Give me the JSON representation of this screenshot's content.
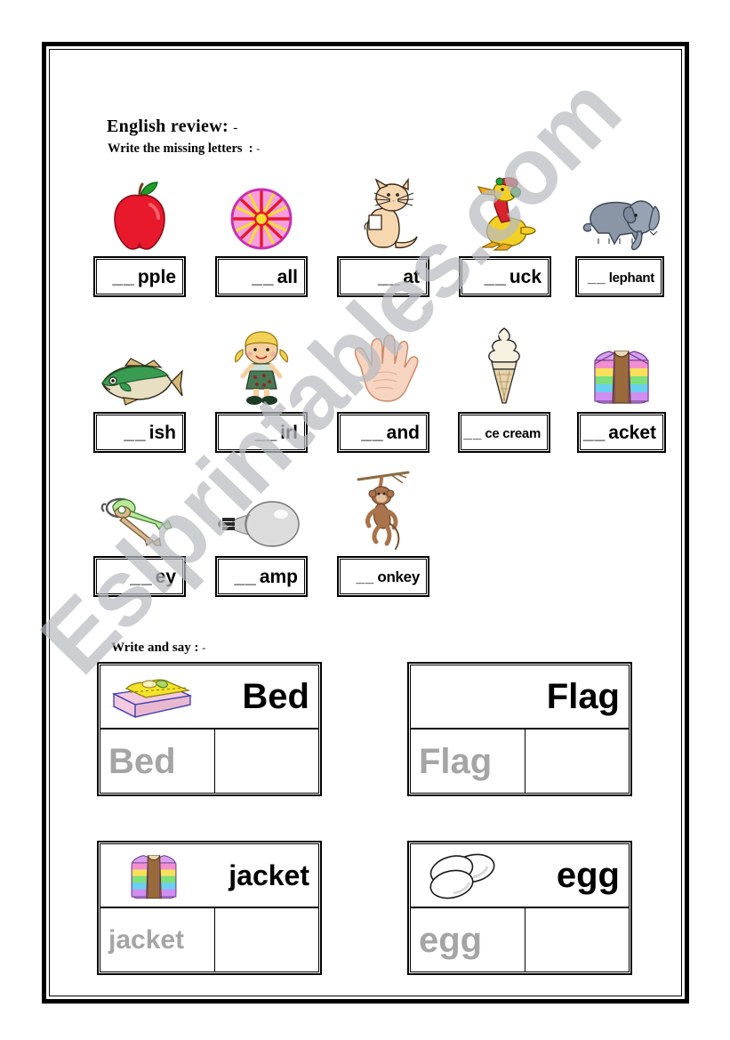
{
  "document": {
    "type": "esl-worksheet",
    "watermark": "Eslprintables.com"
  },
  "header": {
    "title": "English review",
    "title_suffix": ":",
    "title_dash": "-",
    "subtitle": "Write the missing letters",
    "subtitle_suffix": ":",
    "subtitle_dash": "-"
  },
  "missing_letters": {
    "rows": [
      {
        "items": [
          {
            "picture": "apple-icon",
            "blanks": "__",
            "word_fragment": "pple",
            "answer": "apple"
          },
          {
            "picture": "ball-icon",
            "blanks": "__",
            "word_fragment": "all",
            "answer": "ball"
          },
          {
            "picture": "cat-icon",
            "blanks": "__",
            "word_fragment": "at",
            "answer": "cat"
          },
          {
            "picture": "duck-icon",
            "blanks": "__",
            "word_fragment": "uck",
            "answer": "duck"
          },
          {
            "picture": "elephant-icon",
            "blanks": "__",
            "word_fragment": "lephant",
            "answer": "elephant"
          }
        ]
      },
      {
        "items": [
          {
            "picture": "fish-icon",
            "blanks": "__",
            "word_fragment": "ish",
            "answer": "fish"
          },
          {
            "picture": "girl-icon",
            "blanks": "__",
            "word_fragment": "irl",
            "answer": "girl"
          },
          {
            "picture": "hand-icon",
            "blanks": "__",
            "word_fragment": "and",
            "answer": "hand"
          },
          {
            "picture": "ice-cream-icon",
            "blanks": "__",
            "word_fragment": "ce cream",
            "answer": "ice cream"
          },
          {
            "picture": "jacket-icon",
            "blanks": "__",
            "word_fragment": "acket",
            "answer": "jacket"
          }
        ]
      },
      {
        "items": [
          {
            "picture": "key-icon",
            "blanks": "__",
            "word_fragment": "ey",
            "answer": "key"
          },
          {
            "picture": "lamp-icon",
            "blanks": "__",
            "word_fragment": "amp",
            "answer": "lamp"
          },
          {
            "picture": "monkey-icon",
            "blanks": "__",
            "word_fragment": "onkey",
            "answer": "monkey"
          }
        ]
      }
    ]
  },
  "write_and_say": {
    "title": "Write and say",
    "title_suffix": ":",
    "title_dash": "-",
    "cards": [
      {
        "picture": "bed-icon",
        "word": "Bed",
        "trace": "Bed",
        "blank": ""
      },
      {
        "picture": "none",
        "word": "Flag",
        "trace": "Flag",
        "blank": ""
      },
      {
        "picture": "jacket-icon",
        "word": "jacket",
        "trace": "jacket",
        "blank": ""
      },
      {
        "picture": "egg-icon",
        "word": "egg",
        "trace": "egg",
        "blank": ""
      }
    ]
  },
  "colors": {
    "border": "#000000",
    "trace_gray": "#a5a5a5",
    "watermark_gray": "#b9bcc2",
    "apple_red": "#e8192c",
    "leaf_green": "#229b2a",
    "ball_magenta": "#e03ec4",
    "cat_tan": "#f0c99a",
    "duck_yellow": "#f2d025",
    "duck_red": "#d8232a",
    "elephant_gray": "#8a96a6",
    "fish_green": "#3a9b52",
    "girl_hair": "#f2d255",
    "girl_dress": "#4a7a55",
    "hand_pink": "#f7d4c0",
    "icecream_cream": "#f4ead3",
    "key_green": "#bfe9a0",
    "lamp_gray": "#d8d8d8",
    "monkey_brown": "#a9734b",
    "bed_yellow": "#f2e22a",
    "bed_pink": "#f3c9de",
    "bed_blue": "#3a3ab0"
  }
}
